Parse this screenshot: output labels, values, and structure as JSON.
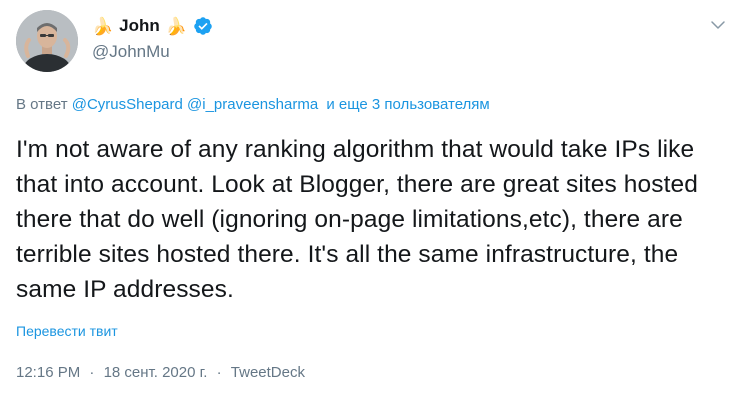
{
  "author": {
    "display_name": "John",
    "handle": "@JohnMu",
    "name_emoji_left": "🍌",
    "name_emoji_right": "🍌",
    "verified": true
  },
  "reply": {
    "prefix": "В ответ",
    "mention_1": "@CyrusShepard",
    "mention_2": "@i_praveensharma",
    "more": "и еще 3 пользователям"
  },
  "tweet": {
    "text": "I'm not aware of any ranking algorithm that would take IPs like that into account. Look at Blogger, there are great sites hosted there that do well (ignoring on-page limitations,etc), there are terrible sites hosted there. It's all the same infrastructure, the same IP addresses.",
    "translate_label": "Перевести твит"
  },
  "meta": {
    "time": "12:16 PM",
    "separator": "·",
    "date": "18 сент. 2020 г.",
    "source": "TweetDeck"
  },
  "colors": {
    "link": "#1b95e0",
    "secondary_text": "#657786",
    "primary_text": "#14171a",
    "verified": "#1da1f2"
  },
  "icons": {
    "menu": "chevron-down-icon",
    "verified": "verified-badge-icon"
  }
}
